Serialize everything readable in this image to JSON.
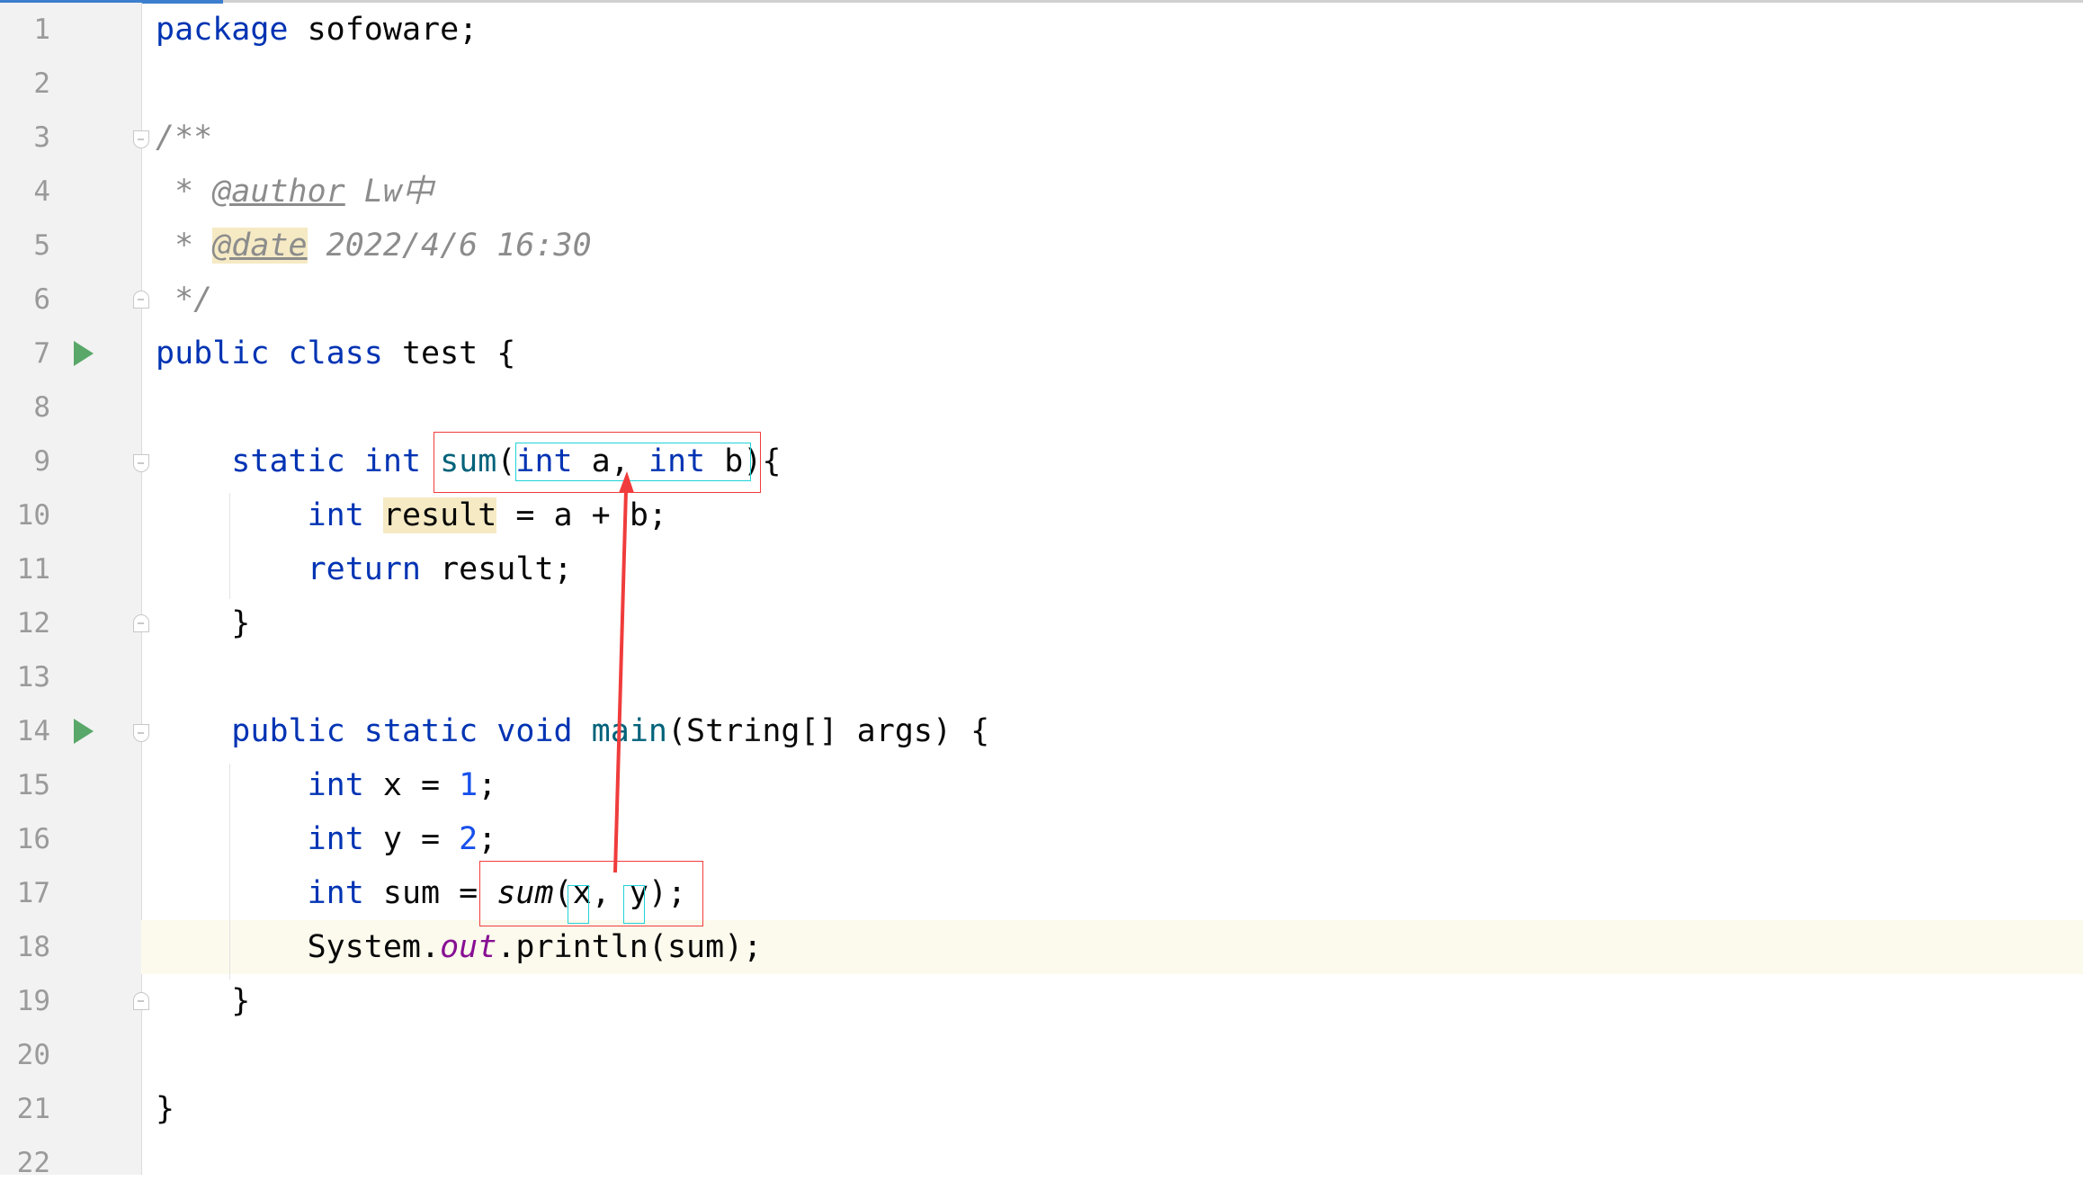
{
  "editor": {
    "current_line": 18,
    "run_lines": [
      7,
      14
    ],
    "fold_open_lines": [
      3,
      9,
      14
    ],
    "fold_close_lines": [
      6,
      12,
      19
    ],
    "lines": [
      {
        "n": "1",
        "tokens": [
          {
            "k": "kw",
            "t": "package"
          },
          {
            "k": "",
            "t": " sofoware;"
          }
        ]
      },
      {
        "n": "2",
        "tokens": []
      },
      {
        "n": "3",
        "tokens": [
          {
            "k": "cm",
            "t": "/**"
          }
        ]
      },
      {
        "n": "4",
        "tokens": [
          {
            "k": "cm",
            "t": " * "
          },
          {
            "k": "tag",
            "t": "@author"
          },
          {
            "k": "cm",
            "t": " Lw中"
          }
        ]
      },
      {
        "n": "5",
        "tokens": [
          {
            "k": "cm",
            "t": " * "
          },
          {
            "k": "tagh",
            "t": "@date"
          },
          {
            "k": "cm",
            "t": " 2022/4/6 16:30"
          }
        ]
      },
      {
        "n": "6",
        "tokens": [
          {
            "k": "cm",
            "t": " */"
          }
        ]
      },
      {
        "n": "7",
        "tokens": [
          {
            "k": "kw",
            "t": "public class"
          },
          {
            "k": "",
            "t": " test {"
          }
        ]
      },
      {
        "n": "8",
        "tokens": []
      },
      {
        "n": "9",
        "tokens": [
          {
            "k": "",
            "t": "    "
          },
          {
            "k": "kw",
            "t": "static int"
          },
          {
            "k": "",
            "t": " "
          },
          {
            "k": "fn",
            "t": "sum"
          },
          {
            "k": "",
            "t": "("
          },
          {
            "k": "kw",
            "t": "int"
          },
          {
            "k": "",
            "t": " a, "
          },
          {
            "k": "kw",
            "t": "int"
          },
          {
            "k": "",
            "t": " b){"
          }
        ]
      },
      {
        "n": "10",
        "tokens": [
          {
            "k": "",
            "t": "        "
          },
          {
            "k": "kw",
            "t": "int"
          },
          {
            "k": "",
            "t": " "
          },
          {
            "k": "hl",
            "t": "result"
          },
          {
            "k": "",
            "t": " = a + b;"
          }
        ]
      },
      {
        "n": "11",
        "tokens": [
          {
            "k": "",
            "t": "        "
          },
          {
            "k": "kw",
            "t": "return"
          },
          {
            "k": "",
            "t": " result;"
          }
        ]
      },
      {
        "n": "12",
        "tokens": [
          {
            "k": "",
            "t": "    }"
          }
        ]
      },
      {
        "n": "13",
        "tokens": []
      },
      {
        "n": "14",
        "tokens": [
          {
            "k": "",
            "t": "    "
          },
          {
            "k": "kw",
            "t": "public static void"
          },
          {
            "k": "",
            "t": " "
          },
          {
            "k": "fn",
            "t": "main"
          },
          {
            "k": "",
            "t": "(String[] args) {"
          }
        ]
      },
      {
        "n": "15",
        "tokens": [
          {
            "k": "",
            "t": "        "
          },
          {
            "k": "kw",
            "t": "int"
          },
          {
            "k": "",
            "t": " x = "
          },
          {
            "k": "num",
            "t": "1"
          },
          {
            "k": "",
            "t": ";"
          }
        ]
      },
      {
        "n": "16",
        "tokens": [
          {
            "k": "",
            "t": "        "
          },
          {
            "k": "kw",
            "t": "int"
          },
          {
            "k": "",
            "t": " y = "
          },
          {
            "k": "num",
            "t": "2"
          },
          {
            "k": "",
            "t": ";"
          }
        ]
      },
      {
        "n": "17",
        "tokens": [
          {
            "k": "",
            "t": "        "
          },
          {
            "k": "kw",
            "t": "int"
          },
          {
            "k": "",
            "t": " sum = "
          },
          {
            "k": "it",
            "t": "sum"
          },
          {
            "k": "",
            "t": "(x, y);"
          }
        ]
      },
      {
        "n": "18",
        "tokens": [
          {
            "k": "",
            "t": "        System."
          },
          {
            "k": "field",
            "t": "out"
          },
          {
            "k": "",
            "t": ".println(sum);"
          }
        ]
      },
      {
        "n": "19",
        "tokens": [
          {
            "k": "",
            "t": "    }"
          }
        ]
      },
      {
        "n": "20",
        "tokens": []
      },
      {
        "n": "21",
        "tokens": [
          {
            "k": "",
            "t": "}"
          }
        ]
      },
      {
        "n": "22",
        "tokens": []
      }
    ]
  },
  "annotation": {
    "box_color": "#f03c3c",
    "param_color": "#1fd3d8",
    "arrow_color": "#f03c3c"
  }
}
